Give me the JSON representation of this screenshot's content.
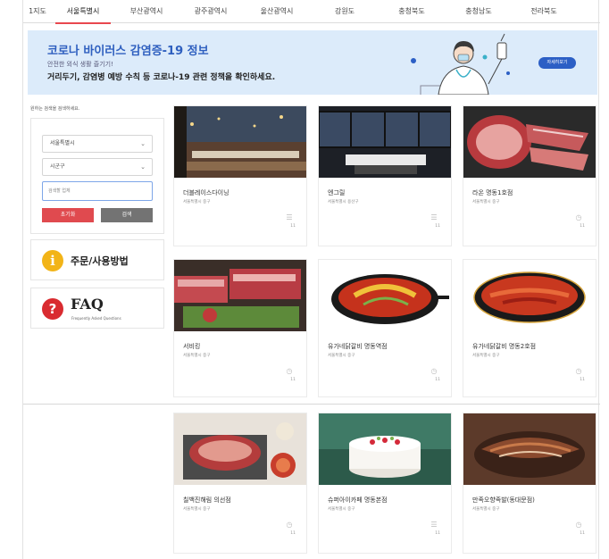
{
  "tabs": [
    {
      "label": "1지도",
      "active": false
    },
    {
      "label": "서울특별시",
      "active": true
    },
    {
      "label": "부산광역시",
      "active": false
    },
    {
      "label": "광주광역시",
      "active": false
    },
    {
      "label": "울산광역시",
      "active": false
    },
    {
      "label": "강원도",
      "active": false
    },
    {
      "label": "충청북도",
      "active": false
    },
    {
      "label": "충청남도",
      "active": false
    },
    {
      "label": "전라북도",
      "active": false
    }
  ],
  "banner": {
    "title": "코로나 바이러스 감염증-19 정보",
    "subtitle": "안전한 외식 생활 즐기기!",
    "description": "거리두기, 감염병 예방 수칙 등 코로나-19 관련 정책을 확인하세요.",
    "button": "자세히보기"
  },
  "sidebar": {
    "hint": "원하는 검색을 검색하세요.",
    "city_select": "서울특별시",
    "district_select": "시군구",
    "search_placeholder": "검색할 업체",
    "reset_button": "초기화",
    "search_button": "검색",
    "usage_icon": "i",
    "usage_label": "주문/사용방법",
    "faq_icon": "?",
    "faq_label": "FAQ",
    "faq_sub": "Frequently Asked Questions"
  },
  "cards": [
    {
      "name": "더블레이스다이닝",
      "addr": "서울특별시 중구",
      "count": "11"
    },
    {
      "name": "엔그릴",
      "addr": "서울특별시 용산구",
      "count": "11"
    },
    {
      "name": "라온 명동1호점",
      "addr": "서울특별시 중구",
      "count": "11"
    },
    {
      "name": "서비킹",
      "addr": "서울특별시 중구",
      "count": "11"
    },
    {
      "name": "유가네닭갈비 명동역점",
      "addr": "서울특별시 중구",
      "count": "11"
    },
    {
      "name": "유가네닭갈비 명동2호점",
      "addr": "서울특별시 중구",
      "count": "11"
    },
    {
      "name": "칠백진해림 의선점",
      "addr": "서울특별시 중구",
      "count": "11"
    },
    {
      "name": "슈퍼아이카페 명동본점",
      "addr": "서울특별시 중구",
      "count": "11"
    },
    {
      "name": "만족오향족발(동대문점)",
      "addr": "서울특별시 중구",
      "count": "11"
    }
  ],
  "colors": {
    "accent_red": "#e04a4f",
    "banner_bg": "#dcebfa",
    "banner_title": "#2e5fbf"
  }
}
